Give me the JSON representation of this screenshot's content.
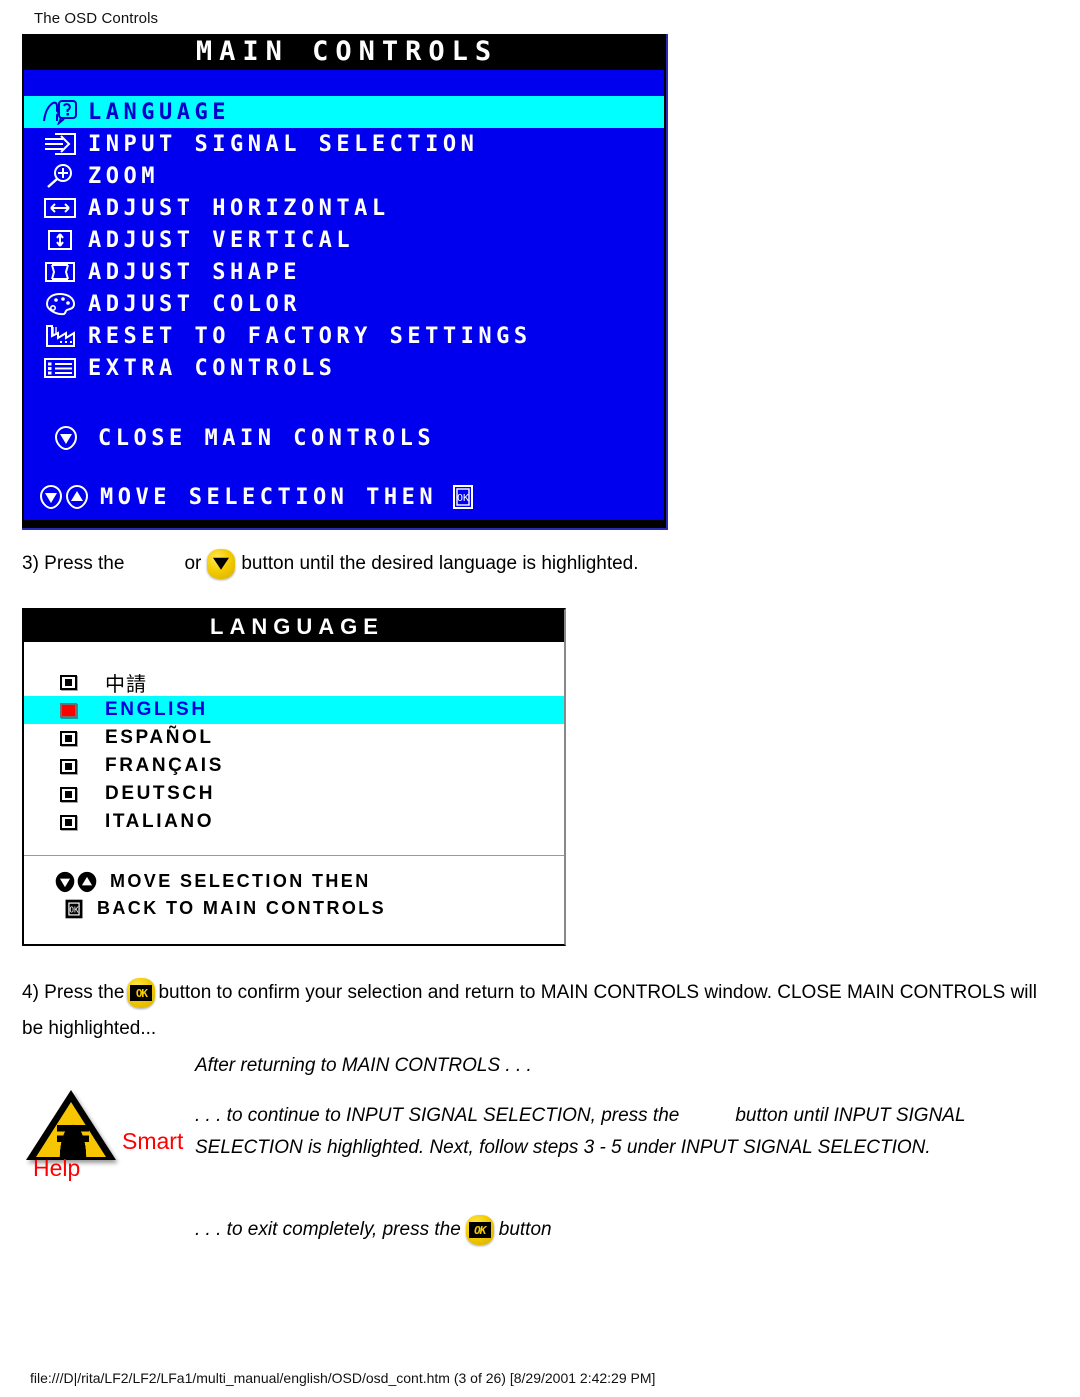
{
  "page": {
    "heading": "The OSD Controls",
    "footer": "file:///D|/rita/LF2/LF2/LFa1/multi_manual/english/OSD/osd_cont.htm (3 of 26) [8/29/2001 2:42:29 PM]"
  },
  "colors": {
    "osd_blue": "#0000ee",
    "osd_highlight": "#00ffff",
    "osd_black": "#000000",
    "osd_text": "#ffffff",
    "selected_text": "#0000cc",
    "button_yellow": "#f4cc00",
    "radio_selected": "#ff0000",
    "smart_help_red": "#ff0000"
  },
  "main_controls": {
    "title": "MAIN CONTROLS",
    "items": [
      {
        "icon": "language-face-question-icon",
        "label": "LANGUAGE",
        "selected": true
      },
      {
        "icon": "input-signal-arrow-icon",
        "label": "INPUT SIGNAL SELECTION",
        "selected": false
      },
      {
        "icon": "zoom-magnifier-plus-icon",
        "label": "ZOOM",
        "selected": false
      },
      {
        "icon": "adjust-horizontal-arrows-icon",
        "label": "ADJUST HORIZONTAL",
        "selected": false
      },
      {
        "icon": "adjust-vertical-arrows-icon",
        "label": "ADJUST VERTICAL",
        "selected": false
      },
      {
        "icon": "adjust-shape-icon",
        "label": "ADJUST SHAPE",
        "selected": false
      },
      {
        "icon": "adjust-color-palette-icon",
        "label": "ADJUST COLOR",
        "selected": false
      },
      {
        "icon": "reset-factory-icon",
        "label": "RESET TO FACTORY SETTINGS",
        "selected": false
      },
      {
        "icon": "extra-controls-list-icon",
        "label": "EXTRA CONTROLS",
        "selected": false
      }
    ],
    "close_item": {
      "icon": "close-down-arrow-icon",
      "label": "CLOSE MAIN CONTROLS"
    },
    "footer_hint": "MOVE SELECTION THEN"
  },
  "step3": {
    "prefix": "3) Press the",
    "or": "or",
    "suffix": "button until the desired language is highlighted."
  },
  "language_panel": {
    "title": "LANGUAGE",
    "items": [
      {
        "label": "中請",
        "selected": false,
        "cjk": true
      },
      {
        "label": "ENGLISH",
        "selected": true,
        "cjk": false
      },
      {
        "label": "ESPAÑOL",
        "selected": false,
        "cjk": false
      },
      {
        "label": "FRANÇAIS",
        "selected": false,
        "cjk": false
      },
      {
        "label": "DEUTSCH",
        "selected": false,
        "cjk": false
      },
      {
        "label": "ITALIANO",
        "selected": false,
        "cjk": false
      }
    ],
    "hint_move": "MOVE SELECTION THEN",
    "hint_back": "BACK TO MAIN CONTROLS"
  },
  "step4": {
    "prefix": "4) Press the",
    "suffix": "button to confirm your selection and return to MAIN CONTROLS window. CLOSE MAIN CONTROLS will be highlighted..."
  },
  "smart_help": {
    "after_line": "After returning to MAIN CONTROLS . . .",
    "smart_word": "Smart",
    "help_word": "Help",
    "body_part1": ". . . to continue to INPUT SIGNAL SELECTION, press the",
    "body_part2": "button until INPUT SIGNAL SELECTION is highlighted. Next, follow steps 3 - 5 under INPUT SIGNAL SELECTION.",
    "exit_prefix": ". . . to exit completely, press the",
    "exit_suffix": "button",
    "ok_glyph": "OK"
  }
}
